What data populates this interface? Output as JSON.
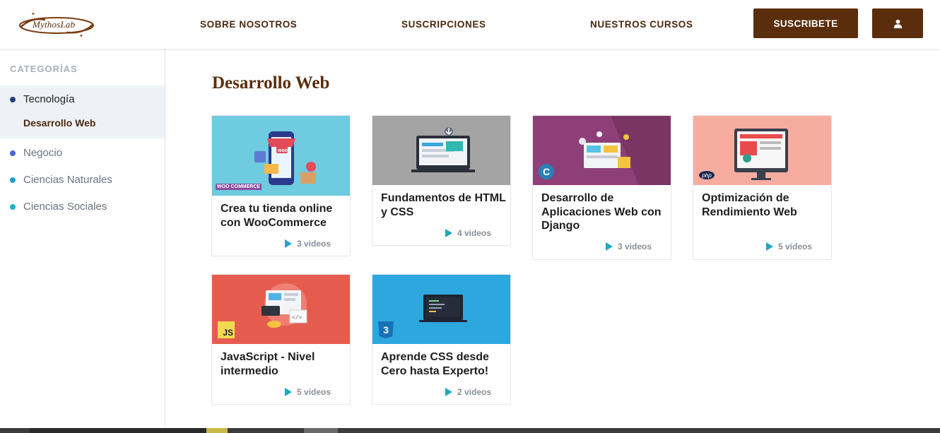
{
  "brand": {
    "logo_text": "MythosLab",
    "brown": "#5a2e0c"
  },
  "nav": {
    "links": [
      "SOBRE NOSOTROS",
      "SUSCRIPCIONES",
      "NUESTROS CURSOS"
    ],
    "subscribe_label": "SUSCRIBETE",
    "user_icon": "user-icon"
  },
  "sidebar": {
    "title": "CATEGORÍAS",
    "categories": [
      {
        "label": "Tecnología",
        "color": "#2c3e7a",
        "active": true,
        "subcategories": [
          "Desarrollo Web"
        ]
      },
      {
        "label": "Negocio",
        "color": "#4a63d6"
      },
      {
        "label": "Ciencias Naturales",
        "color": "#1f9ec7"
      },
      {
        "label": "Ciencias Sociales",
        "color": "#19b3c6"
      }
    ]
  },
  "main": {
    "title": "Desarrollo Web",
    "courses": [
      {
        "title": "Crea tu tienda online con WooCommerce",
        "videos": "3 videos",
        "bg": "#6ecbe0",
        "badge": "WOO COMMERCE"
      },
      {
        "title": "Fundamentos de HTML y CSS",
        "videos": "4 videos",
        "bg": "#a4a4a4",
        "badge": ""
      },
      {
        "title": "Desarrollo de Aplicaciones Web con Django",
        "videos": "3 videos",
        "bg": "#8e3f78",
        "badge": "C"
      },
      {
        "title": "Optimización de Rendimiento Web",
        "videos": "5 videos",
        "bg": "#f6ada0",
        "badge": "php"
      },
      {
        "title": "JavaScript - Nivel intermedio",
        "videos": "5 videos",
        "bg": "#e55c4f",
        "badge": "JS"
      },
      {
        "title": "Aprende CSS desde Cero hasta Experto!",
        "videos": "2 videos",
        "bg": "#2ea7df",
        "badge": "3"
      }
    ]
  }
}
